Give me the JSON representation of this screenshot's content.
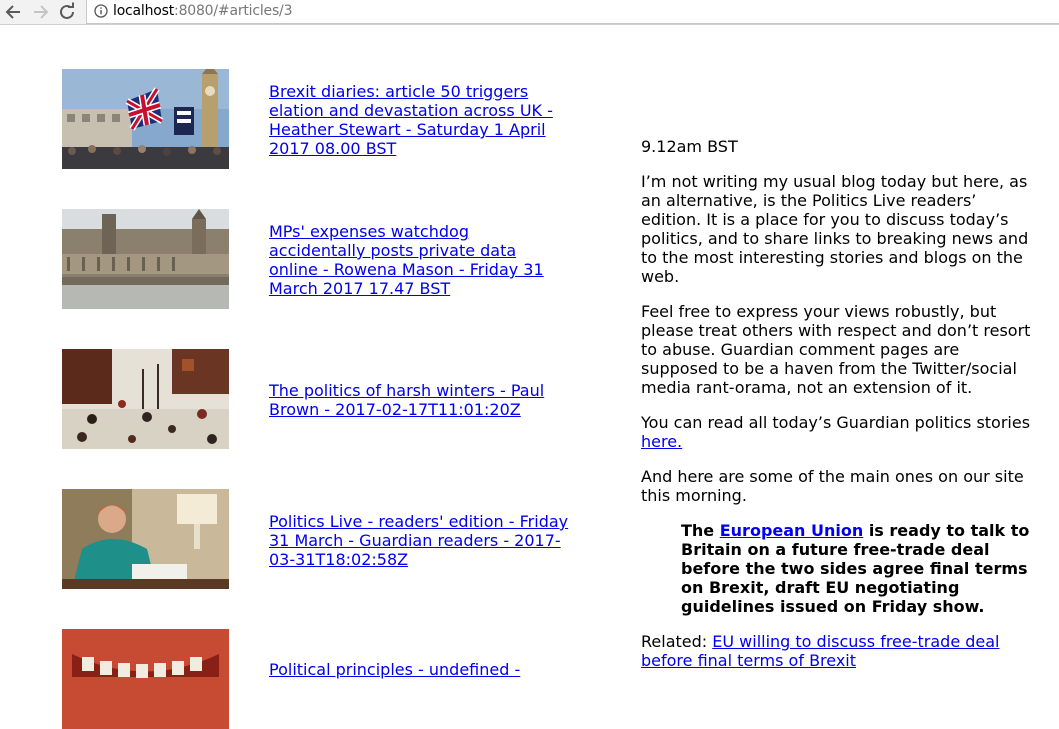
{
  "browser": {
    "url_host": "localhost",
    "url_rest": ":8080/#articles/3"
  },
  "articles": [
    {
      "link": "Brexit diaries: article 50 triggers elation and devastation across UK - Heather Stewart - Saturday 1 April 2017 08.00 BST"
    },
    {
      "link": "MPs' expenses watchdog accidentally posts private data online - Rowena Mason - Friday 31 March 2017 17.47 BST"
    },
    {
      "link": "The politics of harsh winters - Paul Brown - 2017-02-17T11:01:20Z"
    },
    {
      "link": "Politics Live - readers' edition - Friday 31 March - Guardian readers - 2017-03-31T18:02:58Z"
    },
    {
      "link": "Political principles - undefined -"
    }
  ],
  "body": {
    "time": "9.12am BST",
    "para1": "I’m not writing my usual blog today but here, as an alternative, is the Politics Live readers’ edition. It is a place for you to discuss today’s politics, and to share links to breaking news and to the most interesting stories and blogs on the web.",
    "para2": "Feel free to express your views robustly, but please treat others with respect and don’t resort to abuse. Guardian comment pages are supposed to be a haven from the Twitter/social media rant-orama, not an extension of it.",
    "para3_text": "You can read all today’s Guardian politics stories",
    "para3_link": " here.",
    "para4": "And here are some of the main ones on our site this morning.",
    "quote_pre": "The ",
    "quote_link": "European Union",
    "quote_post": " is ready to talk to Britain on a future free-trade deal before the two sides agree final terms on Brexit, draft EU negotiating guidelines issued on Friday show.",
    "related_label": "Related: ",
    "related_link": "EU willing to discuss free-trade deal before final terms of Brexit"
  }
}
